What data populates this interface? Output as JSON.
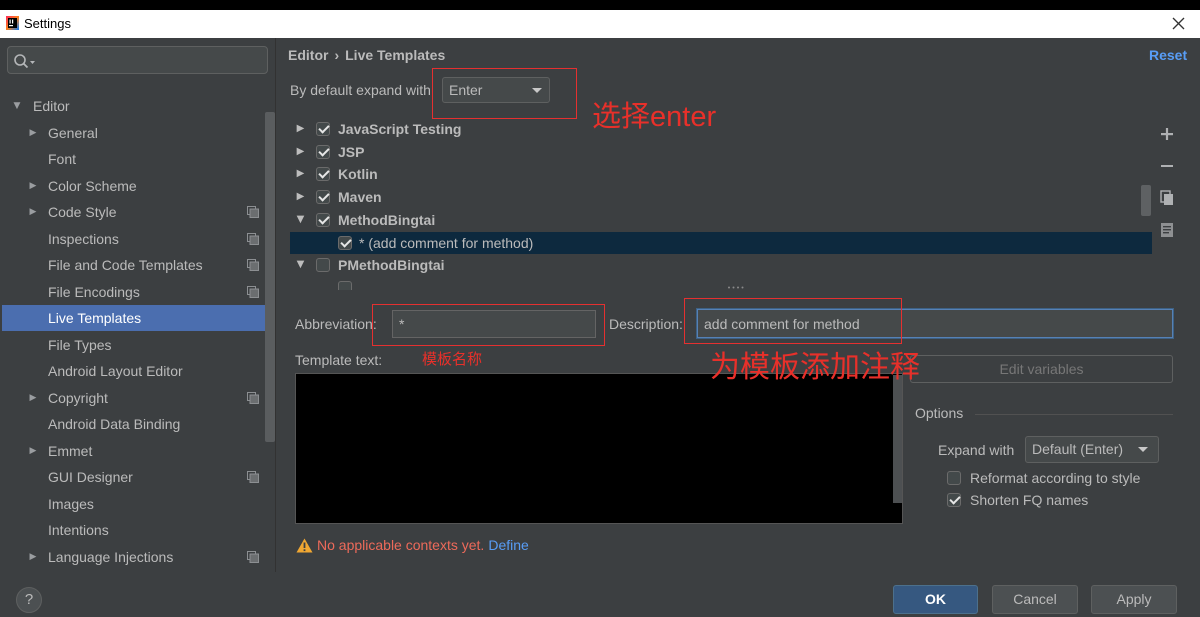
{
  "window": {
    "title": "Settings",
    "app_icon": "intellij-idea-icon",
    "close_icon": "close-icon"
  },
  "sidebar": {
    "search": {
      "value": "",
      "icon": "search-icon"
    },
    "tree": {
      "label": "Editor",
      "arrow": "▼",
      "children": [
        {
          "label": "General",
          "arrow": "▶"
        },
        {
          "label": "Font"
        },
        {
          "label": "Color Scheme",
          "arrow": "▶"
        },
        {
          "label": "Code Style",
          "arrow": "▶",
          "icon": "project-settings-icon"
        },
        {
          "label": "Inspections",
          "icon": "project-settings-icon"
        },
        {
          "label": "File and Code Templates",
          "icon": "project-settings-icon"
        },
        {
          "label": "File Encodings",
          "icon": "project-settings-icon"
        },
        {
          "label": "Live Templates",
          "selected": true
        },
        {
          "label": "File Types"
        },
        {
          "label": "Android Layout Editor"
        },
        {
          "label": "Copyright",
          "arrow": "▶",
          "icon": "project-settings-icon"
        },
        {
          "label": "Android Data Binding"
        },
        {
          "label": "Emmet",
          "arrow": "▶"
        },
        {
          "label": "GUI Designer",
          "icon": "project-settings-icon"
        },
        {
          "label": "Images"
        },
        {
          "label": "Intentions"
        },
        {
          "label": "Language Injections",
          "arrow": "▶",
          "icon": "project-settings-icon"
        }
      ]
    }
  },
  "header": {
    "parent": "Editor",
    "separator": "›",
    "current": "Live Templates",
    "reset": "Reset"
  },
  "expand_default": {
    "label": "By default expand with",
    "value": "Enter"
  },
  "templates": {
    "groups": [
      {
        "label": "JavaScript Testing",
        "checked": true,
        "arrow": "▶"
      },
      {
        "label": "JSP",
        "checked": true,
        "arrow": "▶"
      },
      {
        "label": "Kotlin",
        "checked": true,
        "arrow": "▶"
      },
      {
        "label": "Maven",
        "checked": true,
        "arrow": "▶"
      },
      {
        "label": "MethodBingtai",
        "checked": true,
        "arrow": "▼",
        "children": [
          {
            "label": "* (add comment for method)",
            "checked": true,
            "selected": true
          }
        ]
      },
      {
        "label": "PMethodBingtai",
        "checked": false,
        "arrow": "▼"
      }
    ],
    "toolbar_icons": [
      "add-icon",
      "remove-icon",
      "copy-icon",
      "restore-icon"
    ]
  },
  "editor": {
    "abbreviation": {
      "label": "Abbreviation:",
      "value": "*"
    },
    "description": {
      "label": "Description:",
      "value": "add comment for method"
    },
    "template_text": {
      "label": "Template text:",
      "value": ""
    },
    "edit_variables": "Edit variables",
    "options": {
      "title": "Options",
      "expand_with": {
        "label": "Expand with",
        "value": "Default (Enter)"
      },
      "reformat": {
        "label": "Reformat according to style",
        "checked": false
      },
      "shorten_fq": {
        "label": "Shorten FQ names",
        "checked": true
      }
    },
    "warning": {
      "icon": "warning-icon",
      "text": "No applicable contexts yet.",
      "link": "Define"
    }
  },
  "annotations": {
    "choose_enter": "选择enter",
    "template_name": "模板名称",
    "add_comment": "为模板添加注释"
  },
  "footer": {
    "help": "?",
    "ok": "OK",
    "cancel": "Cancel",
    "apply": "Apply"
  },
  "colors": {
    "selection": "#4b6eaf",
    "selected_row": "#0d293e",
    "link": "#589df6",
    "annotation": "#e8302a",
    "error": "#ed6a5a",
    "default_button": "#365880"
  }
}
